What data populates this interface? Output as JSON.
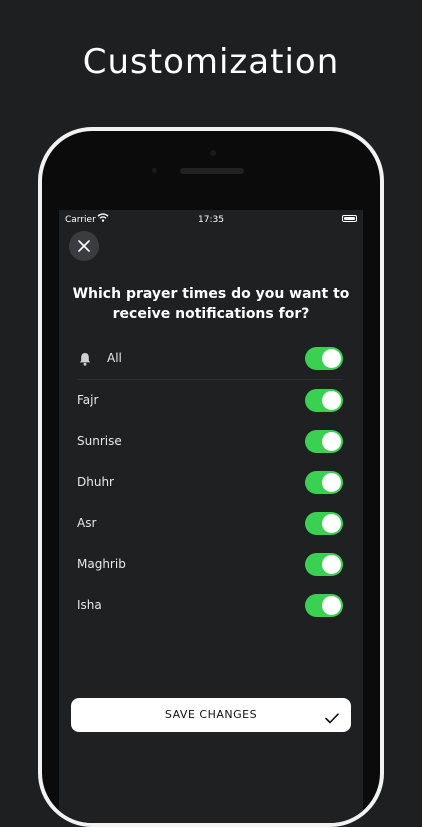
{
  "headline": "Customization",
  "status_bar": {
    "carrier": "Carrier",
    "time": "17:35"
  },
  "question": "Which prayer times do you want to receive notifications for?",
  "prayers": [
    {
      "label": "All",
      "enabled": true,
      "icon": "bell-icon"
    },
    {
      "label": "Fajr",
      "enabled": true
    },
    {
      "label": "Sunrise",
      "enabled": true
    },
    {
      "label": "Dhuhr",
      "enabled": true
    },
    {
      "label": "Asr",
      "enabled": true
    },
    {
      "label": "Maghrib",
      "enabled": true
    },
    {
      "label": "Isha",
      "enabled": true
    }
  ],
  "save_button": {
    "label": "SAVE CHANGES",
    "icon": "checkmark-icon"
  },
  "colors": {
    "toggle_on": "#3ad052",
    "background": "#1d1f21",
    "screen": "#1e2022"
  }
}
